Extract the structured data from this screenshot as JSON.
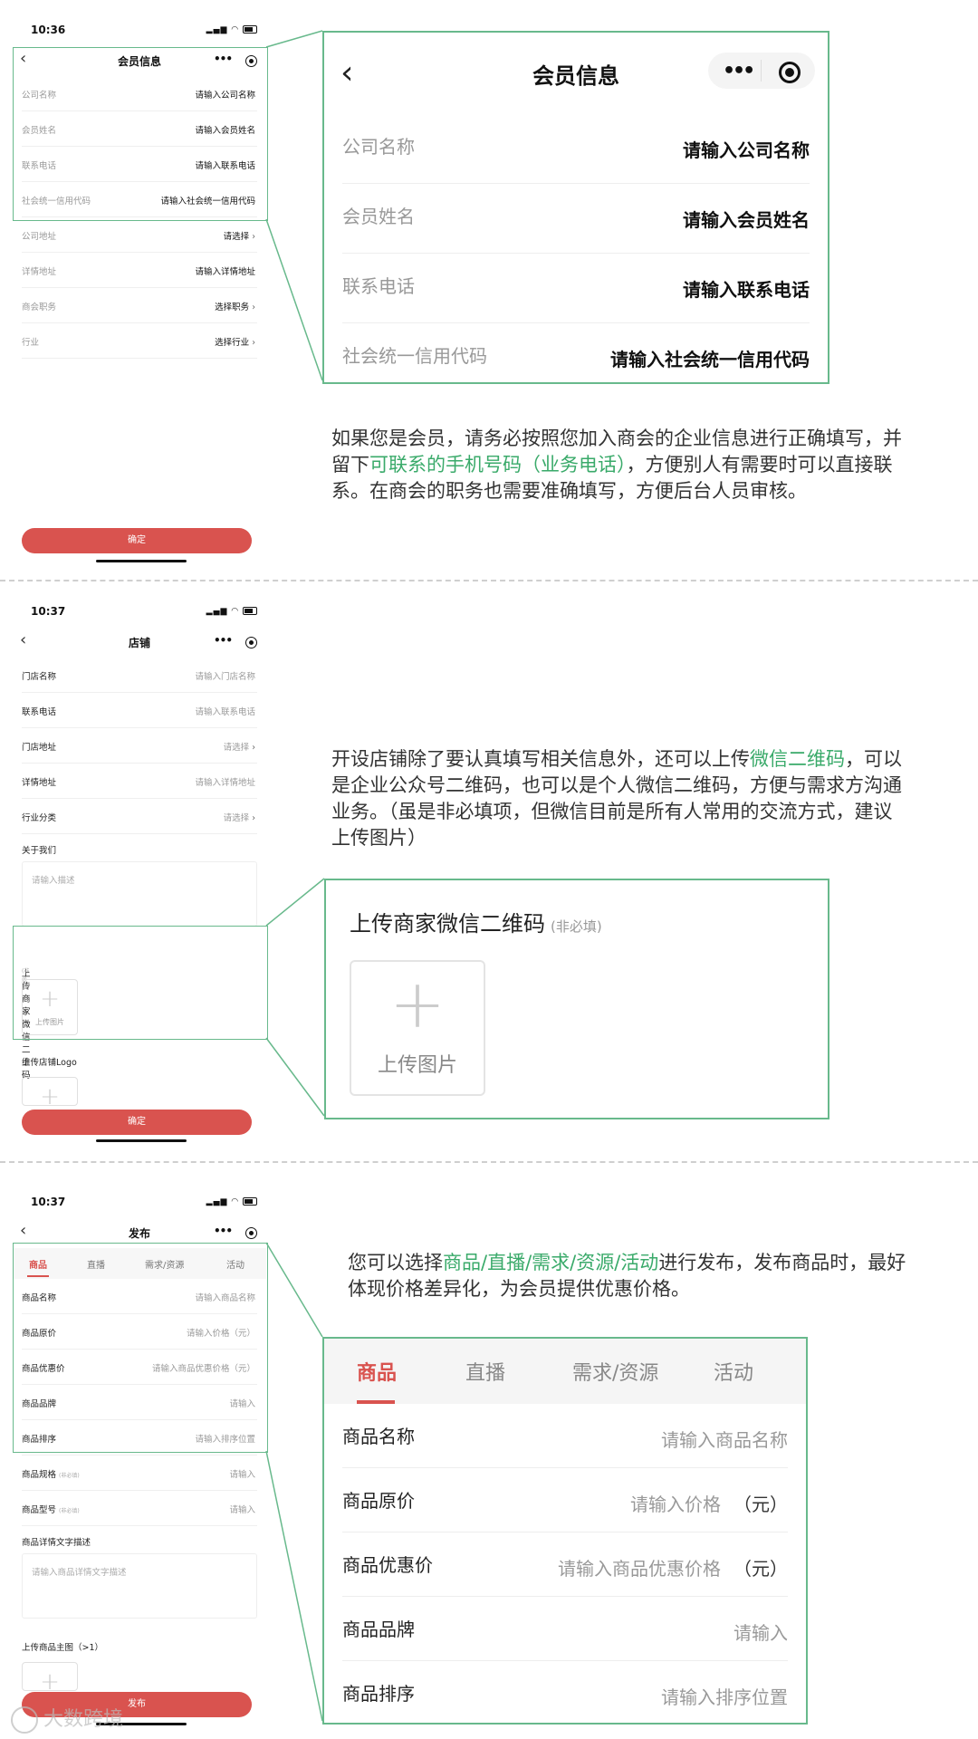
{
  "colors": {
    "accent_green": "#68b98c",
    "highlight_text": "#3aaa6a",
    "button_red": "#d9534f"
  },
  "nav_icons": {
    "back": "chevron-left-icon",
    "more": "more-dots-icon",
    "target": "target-icon"
  },
  "section1": {
    "time": "10:36",
    "title": "会员信息",
    "rows": [
      {
        "label": "公司名称",
        "value": "请输入公司名称"
      },
      {
        "label": "会员姓名",
        "value": "请输入会员姓名"
      },
      {
        "label": "联系电话",
        "value": "请输入联系电话"
      },
      {
        "label": "社会统一信用代码",
        "value": "请输入社会统一信用代码"
      },
      {
        "label": "公司地址",
        "value": "请选择"
      },
      {
        "label": "详情地址",
        "value": "请输入详情地址"
      },
      {
        "label": "商会职务",
        "value": "选择职务"
      },
      {
        "label": "行业",
        "value": "选择行业"
      }
    ],
    "confirm": "确定",
    "desc_part1": "如果您是会员，请务必按照您加入商会的企业信息进行正确填写，并留下",
    "desc_highlight": "可联系的手机号码（业务电话）",
    "desc_part2": "，方便别人有需要时可以直接联系。在商会的职务也需要准确填写，方便后台人员审核。"
  },
  "section2": {
    "time": "10:37",
    "title": "店铺",
    "rows": [
      {
        "label": "门店名称",
        "value": "请输入门店名称"
      },
      {
        "label": "联系电话",
        "value": "请输入联系电话"
      },
      {
        "label": "门店地址",
        "value": "请选择"
      },
      {
        "label": "详情地址",
        "value": "请输入详情地址"
      },
      {
        "label": "行业分类",
        "value": "请选择"
      }
    ],
    "about_label": "关于我们",
    "about_placeholder": "请输入描述",
    "qr_label": "上传商家微信二维码",
    "optional_tag": "(非必填)",
    "upload_text": "上传图片",
    "logo_label": "上传店铺Logo",
    "confirm": "确定",
    "zoom_title": "上传商家微信二维码",
    "zoom_optional": "(非必填)",
    "zoom_upload_text": "上传图片",
    "desc_part1": "开设店铺除了要认真填写相关信息外，还可以上传",
    "desc_highlight": "微信二维码",
    "desc_part2": "，可以是企业公众号二维码，也可以是个人微信二维码，方便与需求方沟通业务。（虽是非必填项，但微信目前是所有人常用的交流方式，建议上传图片）"
  },
  "section3": {
    "time": "10:37",
    "title": "发布",
    "tabs": [
      "商品",
      "直播",
      "需求/资源",
      "活动"
    ],
    "rows": [
      {
        "label": "商品名称",
        "value": "请输入商品名称",
        "unit": ""
      },
      {
        "label": "商品原价",
        "value": "请输入价格",
        "unit": "（元）"
      },
      {
        "label": "商品优惠价",
        "value": "请输入商品优惠价格",
        "unit": "（元）"
      },
      {
        "label": "商品品牌",
        "value": "请输入",
        "unit": ""
      },
      {
        "label": "商品排序",
        "value": "请输入排序位置",
        "unit": ""
      }
    ],
    "extra_rows": [
      {
        "label": "商品规格",
        "tag": "(非必填)",
        "value": "请输入"
      },
      {
        "label": "商品型号",
        "tag": "(非必填)",
        "value": "请输入"
      }
    ],
    "detail_label": "商品详情文字描述",
    "detail_placeholder": "请输入商品详情文字描述",
    "main_img_label": "上传商品主图（>1）",
    "publish": "发布",
    "desc_part1": "您可以选择",
    "desc_highlight": "商品/直播/需求/资源/活动",
    "desc_part2": "进行发布，发布商品时，最好体现价格差异化，为会员提供优惠价格。"
  },
  "watermark": "大数跨境"
}
